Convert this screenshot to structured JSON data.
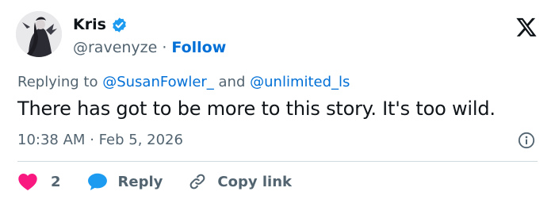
{
  "author": {
    "display_name": "Kris",
    "handle": "@ravenyze",
    "separator": "·",
    "follow_label": "Follow",
    "verified": true
  },
  "reply_context": {
    "prefix": "Replying to",
    "mention_1": "@SusanFowler_",
    "conjunction": "and",
    "mention_2": "@unlimited_ls"
  },
  "tweet": {
    "text": "There has got to be more to this story. It's too wild."
  },
  "meta": {
    "time": "10:38 AM",
    "separator": "·",
    "date": "Feb 5, 2026"
  },
  "actions": {
    "like_count": "2",
    "reply_label": "Reply",
    "copy_link_label": "Copy link"
  },
  "icons": {
    "verified": "verified-badge-icon",
    "platform": "x-logo-icon",
    "info": "info-icon",
    "like": "heart-icon",
    "reply": "speech-bubble-icon",
    "copy": "link-icon"
  },
  "colors": {
    "accent": "#006fd6",
    "verified": "#1d9bf0",
    "heart": "#f91880",
    "text": "#0f1419",
    "secondary": "#536471",
    "divider": "#cfd9de"
  }
}
